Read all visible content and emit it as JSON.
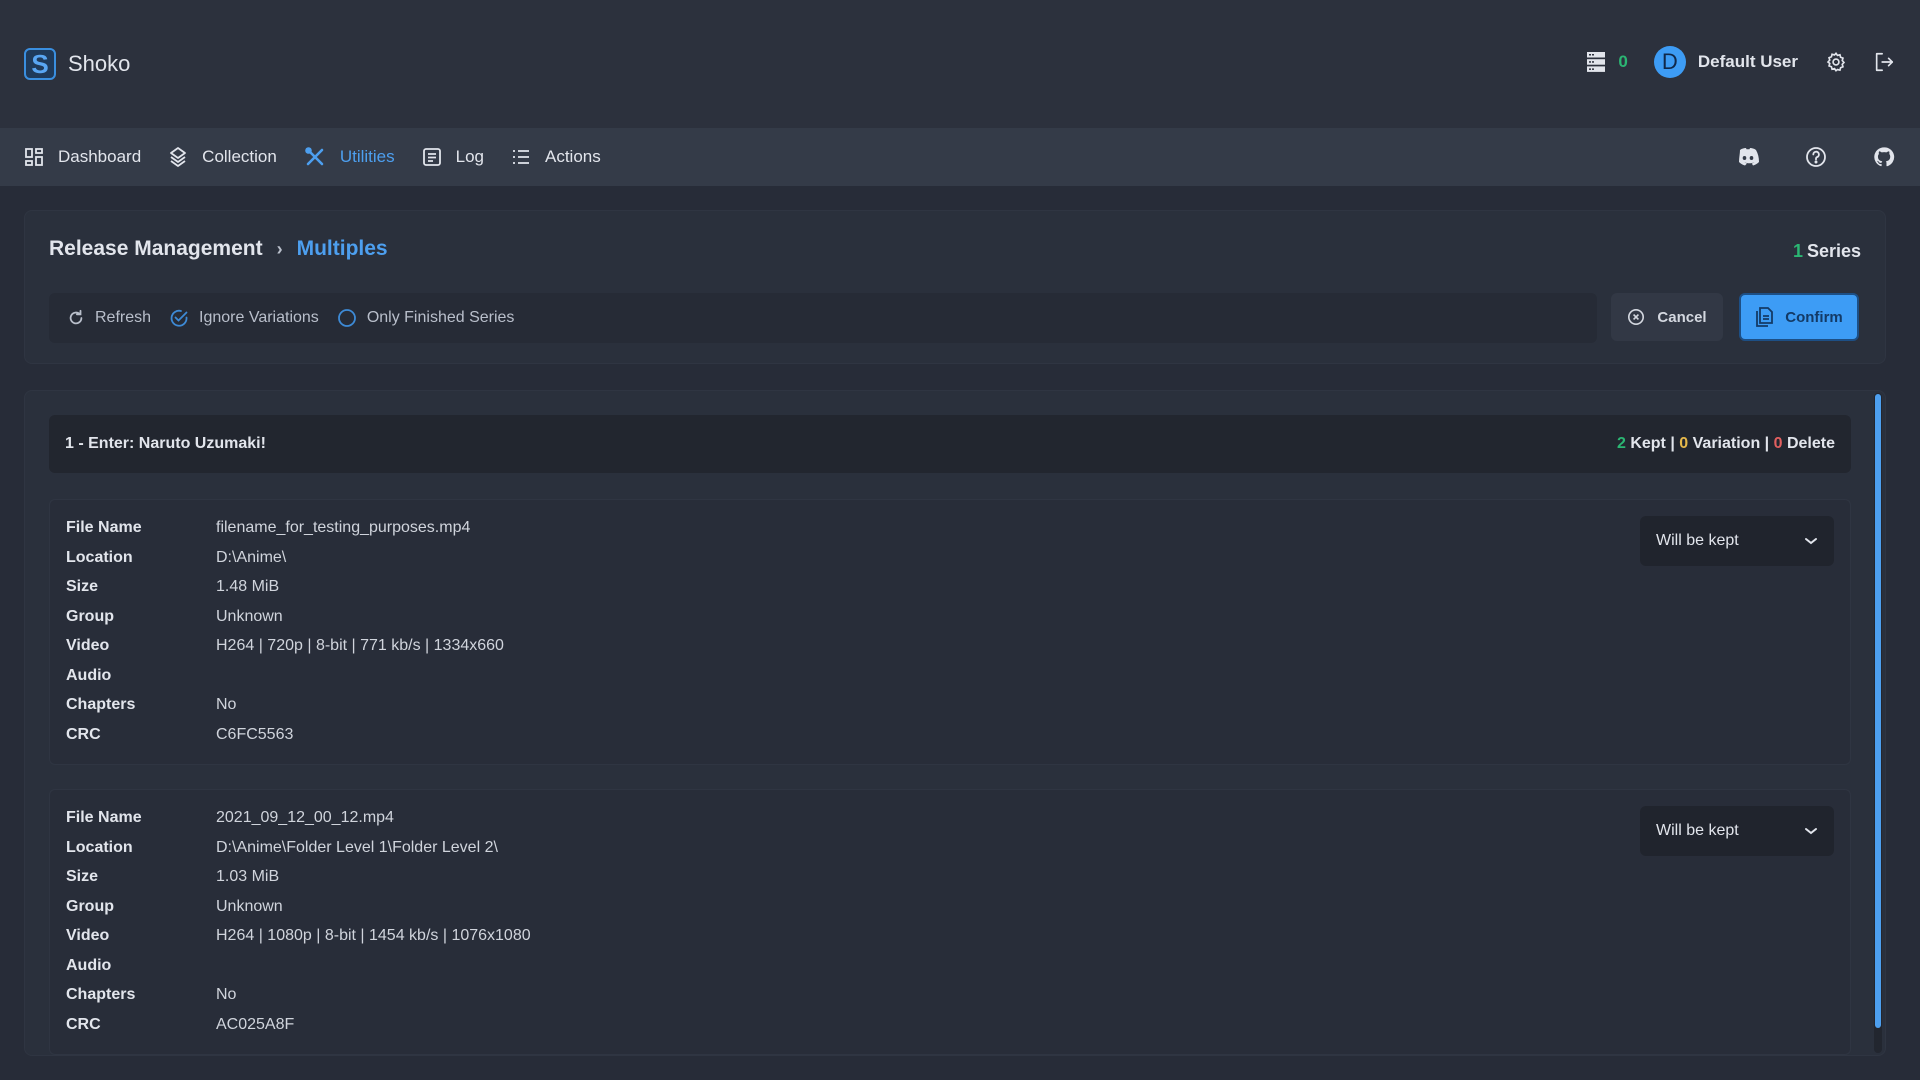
{
  "app": {
    "name": "Shoko",
    "logo_letter": "S"
  },
  "topbar": {
    "queue_count": "0",
    "user": {
      "avatar_letter": "D",
      "name": "Default User"
    }
  },
  "nav": {
    "items": [
      {
        "label": "Dashboard",
        "icon": "dashboard-icon",
        "active": false
      },
      {
        "label": "Collection",
        "icon": "layers-icon",
        "active": false
      },
      {
        "label": "Utilities",
        "icon": "tools-icon",
        "active": true
      },
      {
        "label": "Log",
        "icon": "log-icon",
        "active": false
      },
      {
        "label": "Actions",
        "icon": "list-icon",
        "active": false
      }
    ],
    "right_icons": [
      "discord-icon",
      "help-icon",
      "github-icon"
    ]
  },
  "header": {
    "breadcrumb": [
      "Release Management",
      "Multiples"
    ],
    "series_count": "1",
    "series_label": "Series",
    "toolbar": {
      "refresh": "Refresh",
      "ignore_variations": "Ignore Variations",
      "ignore_variations_checked": true,
      "only_finished": "Only Finished Series",
      "only_finished_checked": false
    },
    "cancel_label": "Cancel",
    "confirm_label": "Confirm"
  },
  "group": {
    "title": "1 - Enter: Naruto Uzumaki!",
    "kept_count": "2",
    "kept_label": "Kept",
    "variation_count": "0",
    "variation_label": "Variation",
    "delete_count": "0",
    "delete_label": "Delete",
    "separator": "|"
  },
  "files": [
    {
      "rows": [
        {
          "k": "File Name",
          "v": "filename_for_testing_purposes.mp4"
        },
        {
          "k": "Location",
          "v": "D:\\Anime\\"
        },
        {
          "k": "Size",
          "v": "1.48 MiB"
        },
        {
          "k": "Group",
          "v": "Unknown"
        },
        {
          "k": "Video",
          "v": "H264 | 720p | 8-bit | 771 kb/s | 1334x660"
        },
        {
          "k": "Audio",
          "v": ""
        },
        {
          "k": "Chapters",
          "v": "No"
        },
        {
          "k": "CRC",
          "v": "C6FC5563"
        }
      ],
      "action": "Will be kept"
    },
    {
      "rows": [
        {
          "k": "File Name",
          "v": "2021_09_12_00_12.mp4"
        },
        {
          "k": "Location",
          "v": "D:\\Anime\\Folder Level 1\\Folder Level 2\\"
        },
        {
          "k": "Size",
          "v": "1.03 MiB"
        },
        {
          "k": "Group",
          "v": "Unknown"
        },
        {
          "k": "Video",
          "v": "H264 | 1080p | 8-bit | 1454 kb/s | 1076x1080"
        },
        {
          "k": "Audio",
          "v": ""
        },
        {
          "k": "Chapters",
          "v": "No"
        },
        {
          "k": "CRC",
          "v": "AC025A8F"
        }
      ],
      "action": "Will be kept"
    }
  ],
  "colors": {
    "accent": "#3d9cf5",
    "success": "#2bb673",
    "warning": "#e6b84a",
    "danger": "#e25f5f"
  }
}
